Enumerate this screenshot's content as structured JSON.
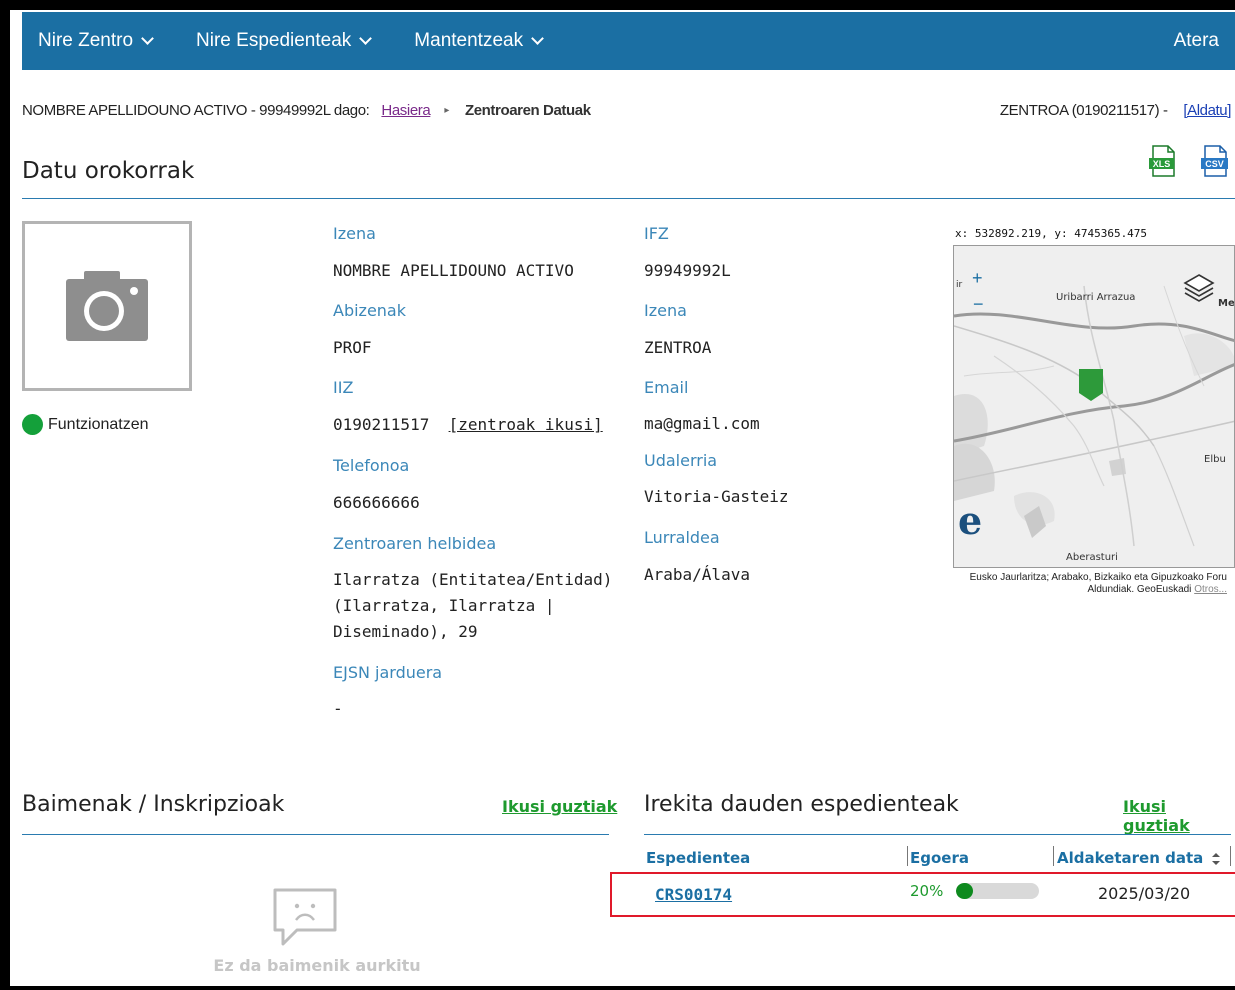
{
  "nav": {
    "items": [
      {
        "label": "Nire Zentro"
      },
      {
        "label": "Nire Espedienteak"
      },
      {
        "label": "Mantentzeak"
      }
    ],
    "logout": "Atera"
  },
  "breadcrumb": {
    "user_text": "NOMBRE APELLIDOUNO ACTIVO - 99949992L dago:",
    "home": "Hasiera",
    "current": "Zentroaren Datuak",
    "center_text": "ZENTROA (0190211517) - ",
    "change_link": "[Aldatu]"
  },
  "page": {
    "title": "Datu orokorrak",
    "export": {
      "xls_icon": "xls-file-icon",
      "csv_icon": "csv-file-icon"
    }
  },
  "profile": {
    "photo_icon": "camera-icon",
    "status": "Funtzionatzen",
    "status_color": "#14a03a"
  },
  "fields_left": {
    "izena_label": "Izena",
    "izena_value": "NOMBRE APELLIDOUNO ACTIVO",
    "abizenak_label": "Abizenak",
    "abizenak_value": "PROF",
    "iiz_label": "IIZ",
    "iiz_value": "0190211517",
    "iiz_link": "[zentroak ikusi]",
    "telefonoa_label": "Telefonoa",
    "telefonoa_value": "666666666",
    "helbidea_label": "Zentroaren helbidea",
    "helbidea_line1": "Ilarratza (Entitatea/Entidad)",
    "helbidea_line2": "(Ilarratza, Ilarratza |",
    "helbidea_line3": "Diseminado), 29",
    "ejsn_label": "EJSN jarduera",
    "ejsn_value": "-"
  },
  "fields_right": {
    "ifz_label": "IFZ",
    "ifz_value": "99949992L",
    "izena_label": "Izena",
    "izena_value": "ZENTROA",
    "email_label": "Email",
    "email_value": "ma@gmail.com",
    "udalerria_label": "Udalerria",
    "udalerria_value": "Vitoria-Gasteiz",
    "lurraldea_label": "Lurraldea",
    "lurraldea_value": "Araba/Álava"
  },
  "map": {
    "coords": "x: 532892.219, y: 4745365.475",
    "zoom_in": "+",
    "zoom_out": "−",
    "layers_icon": "layers-icon",
    "place_1": "Uribarri Arrazua",
    "place_2": "Elbu",
    "place_3": "Aberasturi",
    "place_4": "Me",
    "place_5": "ir",
    "logo": "e",
    "attribution": "Eusko Jaurlaritza; Arabako, Bizkaiko eta Gipuzkoako Foru Aldundiak. GeoEuskadi",
    "attribution_link": "Otros..."
  },
  "permits": {
    "title": "Baimenak / Inskripzioak",
    "see_all": "Ikusi guztiak",
    "empty_icon": "sad-speech-bubble-icon",
    "empty_text": "Ez da baimenik aurkitu"
  },
  "open_files": {
    "title": "Irekita dauden espedienteak",
    "see_all": "Ikusi guztiak",
    "columns": [
      "Espedientea",
      "Egoera",
      "Aldaketaren data"
    ],
    "sort_icon": "sort-icon",
    "rows": [
      {
        "id": "CRS00174",
        "progress_label": "20%",
        "progress": 0.2,
        "date": "2025/03/20"
      }
    ],
    "progress_color": "#0e8a1e",
    "highlight_color": "#e0192a"
  }
}
